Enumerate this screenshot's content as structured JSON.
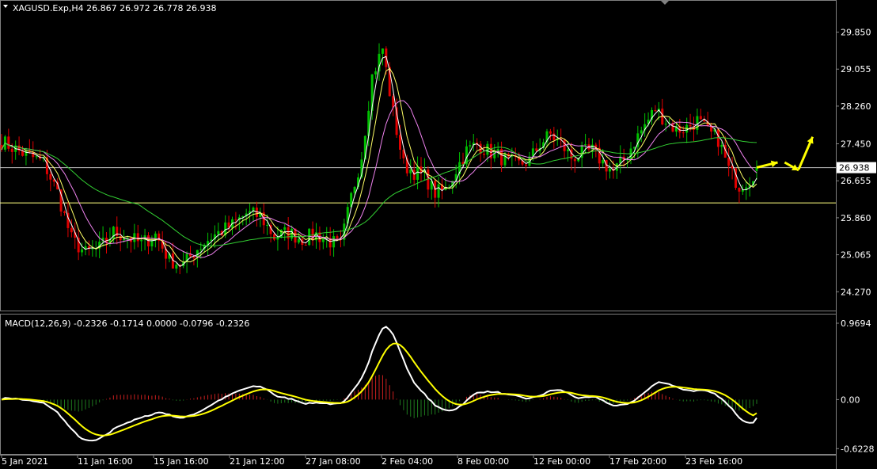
{
  "window": {
    "symbol_header": "XAGUSD.Exp,H4  26.867 26.972 26.778 26.938",
    "macd_header": "MACD(12,26,9) -0.2326 -0.1714 0.0000 -0.0796 -0.2326"
  },
  "colors": {
    "background": "#000000",
    "bull_candle": "#00c000",
    "bear_candle": "#e00000",
    "ma_fast": "#ffffff",
    "ma_yellow": "#ffff66",
    "ma_violet": "#ee82ee",
    "ma_green": "#32cd32",
    "hline_upper": "#c0c0c0",
    "hline_lower": "#ffff80",
    "macd_line": "#ffffff",
    "signal_line": "#ffff00",
    "hist_pos": "#cc2020",
    "hist_neg": "#1e7a1e",
    "arrow": "#ffff00"
  },
  "chart_data": [
    {
      "type": "candlestick",
      "symbol": "XAGUSD.Exp",
      "timeframe": "H4",
      "last_ohlc": {
        "open": 26.867,
        "high": 26.972,
        "low": 26.778,
        "close": 26.938
      },
      "current_price_label": "26.938",
      "ylim": [
        23.9,
        30.2
      ],
      "y_ticks": [
        "29.850",
        "29.055",
        "28.260",
        "27.450",
        "26.655",
        "25.860",
        "25.065",
        "24.270"
      ],
      "x_ticks": [
        "5 Jan 2021",
        "11 Jan 16:00",
        "15 Jan 16:00",
        "21 Jan 12:00",
        "27 Jan 08:00",
        "2 Feb 04:00",
        "8 Feb 00:00",
        "12 Feb 00:00",
        "17 Feb 20:00",
        "23 Feb 16:00"
      ],
      "horizontal_lines": [
        26.938,
        26.18
      ],
      "close_path": [
        [
          0,
          27.5
        ],
        [
          6,
          27.25
        ],
        [
          12,
          27.05
        ],
        [
          16,
          26.4
        ],
        [
          20,
          25.4
        ],
        [
          24,
          25.1
        ],
        [
          28,
          25.2
        ],
        [
          32,
          25.55
        ],
        [
          36,
          25.45
        ],
        [
          40,
          25.3
        ],
        [
          44,
          25.5
        ],
        [
          48,
          24.95
        ],
        [
          52,
          24.85
        ],
        [
          56,
          25.2
        ],
        [
          60,
          25.45
        ],
        [
          66,
          25.7
        ],
        [
          70,
          25.95
        ],
        [
          74,
          25.9
        ],
        [
          78,
          25.45
        ],
        [
          82,
          25.55
        ],
        [
          86,
          25.4
        ],
        [
          90,
          25.5
        ],
        [
          94,
          25.35
        ],
        [
          97,
          25.25
        ],
        [
          100,
          26.3
        ],
        [
          103,
          27.2
        ],
        [
          106,
          28.9
        ],
        [
          109,
          29.5
        ],
        [
          112,
          28.1
        ],
        [
          115,
          27.0
        ],
        [
          118,
          26.85
        ],
        [
          121,
          26.75
        ],
        [
          124,
          26.4
        ],
        [
          127,
          26.45
        ],
        [
          130,
          26.9
        ],
        [
          133,
          27.3
        ],
        [
          136,
          27.45
        ],
        [
          139,
          27.3
        ],
        [
          142,
          27.2
        ],
        [
          145,
          27.05
        ],
        [
          148,
          27.0
        ],
        [
          151,
          27.1
        ],
        [
          154,
          27.45
        ],
        [
          157,
          27.65
        ],
        [
          160,
          27.45
        ],
        [
          163,
          27.15
        ],
        [
          166,
          27.25
        ],
        [
          169,
          27.3
        ],
        [
          172,
          27.05
        ],
        [
          175,
          26.85
        ],
        [
          178,
          27.1
        ],
        [
          181,
          27.5
        ],
        [
          184,
          27.85
        ],
        [
          187,
          28.2
        ],
        [
          190,
          27.95
        ],
        [
          193,
          27.75
        ],
        [
          196,
          27.8
        ],
        [
          199,
          27.95
        ],
        [
          202,
          27.7
        ],
        [
          205,
          27.55
        ],
        [
          208,
          26.9
        ],
        [
          211,
          26.55
        ],
        [
          214,
          26.7
        ],
        [
          216,
          26.94
        ]
      ],
      "moving_averages": [
        {
          "color_key": "ma_fast",
          "period_bars": 3
        },
        {
          "color_key": "ma_yellow",
          "period_bars": 6
        },
        {
          "color_key": "ma_violet",
          "period_bars": 12
        },
        {
          "color_key": "ma_green",
          "period_bars": 40
        }
      ],
      "annotation_arrows": [
        {
          "from": [
            216,
            26.94
          ],
          "to": [
            222,
            27.05
          ]
        },
        {
          "from": [
            224,
            27.05
          ],
          "to": [
            228,
            26.88
          ]
        },
        {
          "from": [
            228,
            26.9
          ],
          "to": [
            232,
            27.6
          ]
        }
      ]
    },
    {
      "type": "macd",
      "params": "MACD(12,26,9)",
      "values": {
        "macd": -0.2326,
        "signal": -0.1714,
        "zero": 0.0,
        "histogram": -0.0796,
        "last": -0.2326
      },
      "ylim": [
        -0.68,
        1.05
      ],
      "y_ticks": [
        "0.9694",
        "0.00",
        "-0.6228"
      ]
    }
  ]
}
